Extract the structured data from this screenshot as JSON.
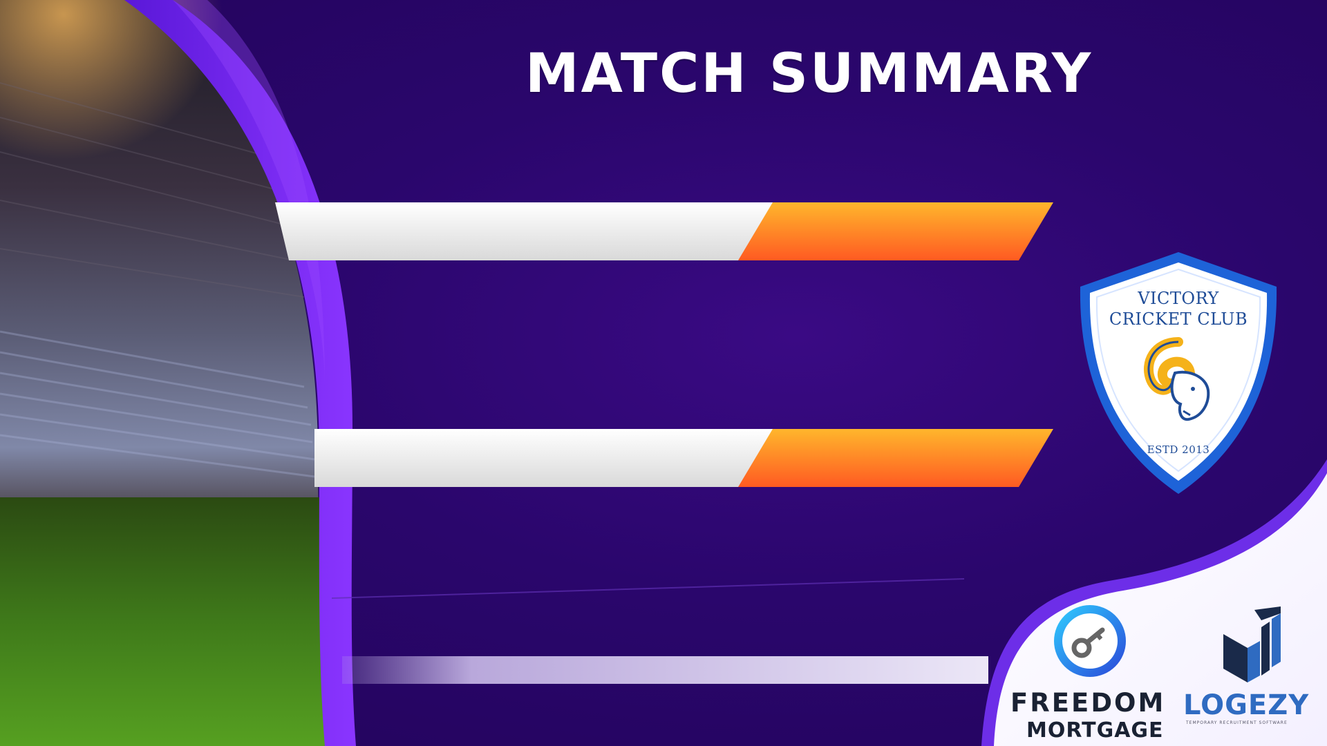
{
  "title": "MATCH SUMMARY",
  "team": {
    "name_line1": "VICTORY",
    "name_line2": "CRICKET CLUB",
    "established": "ESTD 2013"
  },
  "sponsors": {
    "freedom": {
      "line1": "FREEDOM",
      "line2": "MORTGAGE"
    },
    "logezy": {
      "name": "LOGEZY",
      "tagline": "TEMPORARY RECRUITMENT SOFTWARE"
    }
  },
  "colors": {
    "background": "#2a066c",
    "accent_purple": "#7b2cf5",
    "bar_white": "#f2f2f2",
    "bar_orange": "#ff7a22",
    "crest_blue": "#1f4c97",
    "crest_gold": "#f5b21a"
  },
  "icons": {
    "freedom_logo": "key-circle-icon",
    "logezy_logo": "cube-bars-icon",
    "crest_emblem": "ram-head-icon"
  }
}
